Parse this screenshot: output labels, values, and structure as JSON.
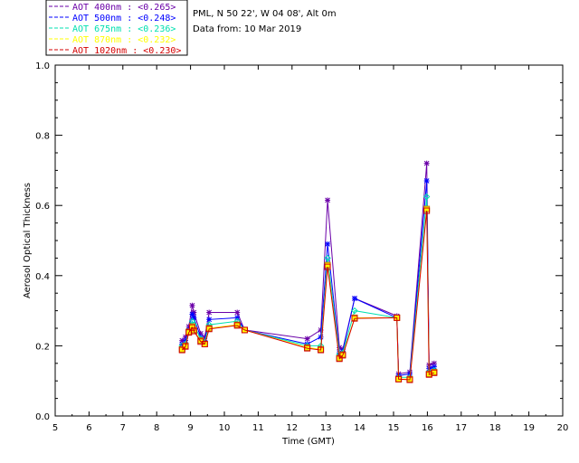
{
  "chart_data": {
    "type": "line",
    "title_lines": [
      "PML, N 50 22', W 04 08', Alt 0m",
      "Data from: 10 Mar 2019"
    ],
    "xlabel": "Time (GMT)",
    "ylabel": "Aerosol Optical Thickness",
    "xlim": [
      5,
      20
    ],
    "ylim": [
      0.0,
      1.0
    ],
    "x_ticks": [
      "5",
      "6",
      "7",
      "8",
      "9",
      "10",
      "11",
      "12",
      "13",
      "14",
      "15",
      "16",
      "17",
      "18",
      "19",
      "20"
    ],
    "y_ticks": [
      "0.0",
      "0.2",
      "0.4",
      "0.6",
      "0.8",
      "1.0"
    ],
    "grid": false,
    "legend_position": "top-left, above plot",
    "legend": [
      "AOT  400nm : <0.265>",
      "AOT  500nm : <0.248>",
      "AOT  675nm : <0.236>",
      "AOT  870nm : <0.232>",
      "AOT 1020nm : <0.230>"
    ],
    "x": [
      8.75,
      8.85,
      8.95,
      9.05,
      9.1,
      9.3,
      9.42,
      9.55,
      10.38,
      10.6,
      12.45,
      12.85,
      13.05,
      13.4,
      13.5,
      13.85,
      15.1,
      15.15,
      15.48,
      15.98,
      16.05,
      16.2
    ],
    "series": [
      {
        "name": "AOT  400nm",
        "color": "#6a00a8",
        "marker": "star",
        "values": [
          0.215,
          0.225,
          0.255,
          0.315,
          0.295,
          0.235,
          0.225,
          0.295,
          0.295,
          0.245,
          0.22,
          0.245,
          0.615,
          0.195,
          0.19,
          0.335,
          0.285,
          0.12,
          0.125,
          0.72,
          0.145,
          0.15
        ]
      },
      {
        "name": "AOT  500nm",
        "color": "#0000ff",
        "marker": "star",
        "values": [
          0.205,
          0.215,
          0.245,
          0.29,
          0.28,
          0.225,
          0.215,
          0.275,
          0.28,
          0.245,
          0.205,
          0.225,
          0.49,
          0.18,
          0.185,
          0.335,
          0.28,
          0.115,
          0.12,
          0.67,
          0.135,
          0.14
        ]
      },
      {
        "name": "AOT  675nm",
        "color": "#00e0b0",
        "marker": "diamond",
        "values": [
          0.2,
          0.205,
          0.24,
          0.27,
          0.26,
          0.22,
          0.21,
          0.26,
          0.27,
          0.245,
          0.2,
          0.2,
          0.45,
          0.175,
          0.18,
          0.3,
          0.28,
          0.11,
          0.11,
          0.625,
          0.125,
          0.13
        ]
      },
      {
        "name": "AOT  870nm",
        "color": "#ffff00",
        "marker": "square",
        "values": [
          0.19,
          0.2,
          0.24,
          0.255,
          0.245,
          0.215,
          0.205,
          0.25,
          0.26,
          0.245,
          0.195,
          0.19,
          0.43,
          0.165,
          0.175,
          0.28,
          0.28,
          0.105,
          0.105,
          0.59,
          0.12,
          0.125
        ]
      },
      {
        "name": "AOT 1020nm",
        "color": "#d40000",
        "marker": "square",
        "values": [
          0.188,
          0.198,
          0.238,
          0.252,
          0.242,
          0.212,
          0.205,
          0.248,
          0.258,
          0.245,
          0.193,
          0.188,
          0.425,
          0.163,
          0.173,
          0.278,
          0.28,
          0.105,
          0.103,
          0.585,
          0.118,
          0.123
        ]
      }
    ]
  },
  "colors": {
    "axis": "#000000",
    "legend_swatch": "#d40000"
  }
}
